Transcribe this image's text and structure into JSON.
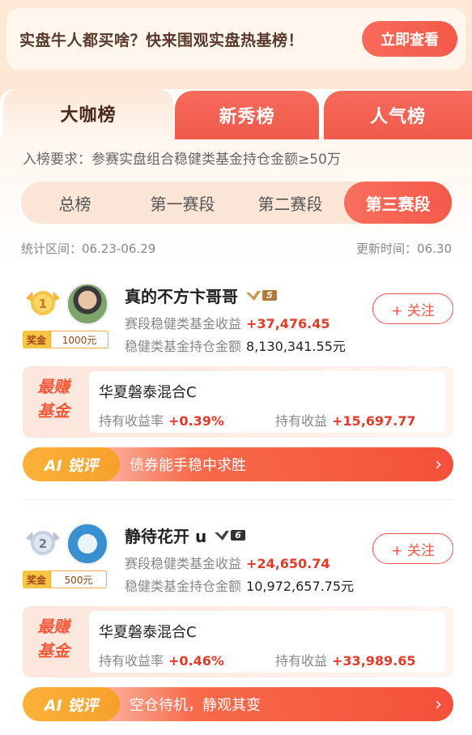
{
  "banner": {
    "text": "实盘牛人都买啥？快来围观实盘热基榜！",
    "button": "立即查看"
  },
  "tabs": [
    {
      "label": "大咖榜",
      "active": true
    },
    {
      "label": "新秀榜",
      "active": false
    },
    {
      "label": "人气榜",
      "active": false
    }
  ],
  "requirement": "入榜要求：参赛实盘组合稳健类基金持仓金额≥50万",
  "periods": [
    {
      "label": "总榜",
      "active": false
    },
    {
      "label": "第一赛段",
      "active": false
    },
    {
      "label": "第二赛段",
      "active": false
    },
    {
      "label": "第三赛段",
      "active": true
    }
  ],
  "stats": {
    "range": "统计区间：06.23-06.29",
    "updated": "更新时间：06.30"
  },
  "entries": [
    {
      "rank": "1",
      "prize_tag": "奖金",
      "prize_amount": "1000元",
      "name": "真的不方卞哥哥",
      "level": "5",
      "income_label": "赛段稳健类基金收益",
      "income_value": "+37,476.45",
      "holding_label": "稳健类基金持仓金额",
      "holding_value": "8,130,341.55元",
      "follow": "+ 关注",
      "fund_label_1": "最赚",
      "fund_label_2": "基金",
      "fund_name": "华夏磐泰混合C",
      "rate_label": "持有收益率",
      "rate_value": "+0.39%",
      "gain_label": "持有收益",
      "gain_value": "+15,697.77",
      "ai_tag": "AI 锐评",
      "ai_text": "债券能手稳中求胜",
      "chevron": "›"
    },
    {
      "rank": "2",
      "prize_tag": "奖金",
      "prize_amount": "500元",
      "name": "静待花开 u",
      "level": "6",
      "income_label": "赛段稳健类基金收益",
      "income_value": "+24,650.74",
      "holding_label": "稳健类基金持仓金额",
      "holding_value": "10,972,657.75元",
      "follow": "+ 关注",
      "fund_label_1": "最赚",
      "fund_label_2": "基金",
      "fund_name": "华夏磐泰混合C",
      "rate_label": "持有收益率",
      "rate_value": "+0.46%",
      "gain_label": "持有收益",
      "gain_value": "+33,989.65",
      "ai_tag": "AI 锐评",
      "ai_text": "空仓待机，静观其变",
      "chevron": "›"
    }
  ]
}
